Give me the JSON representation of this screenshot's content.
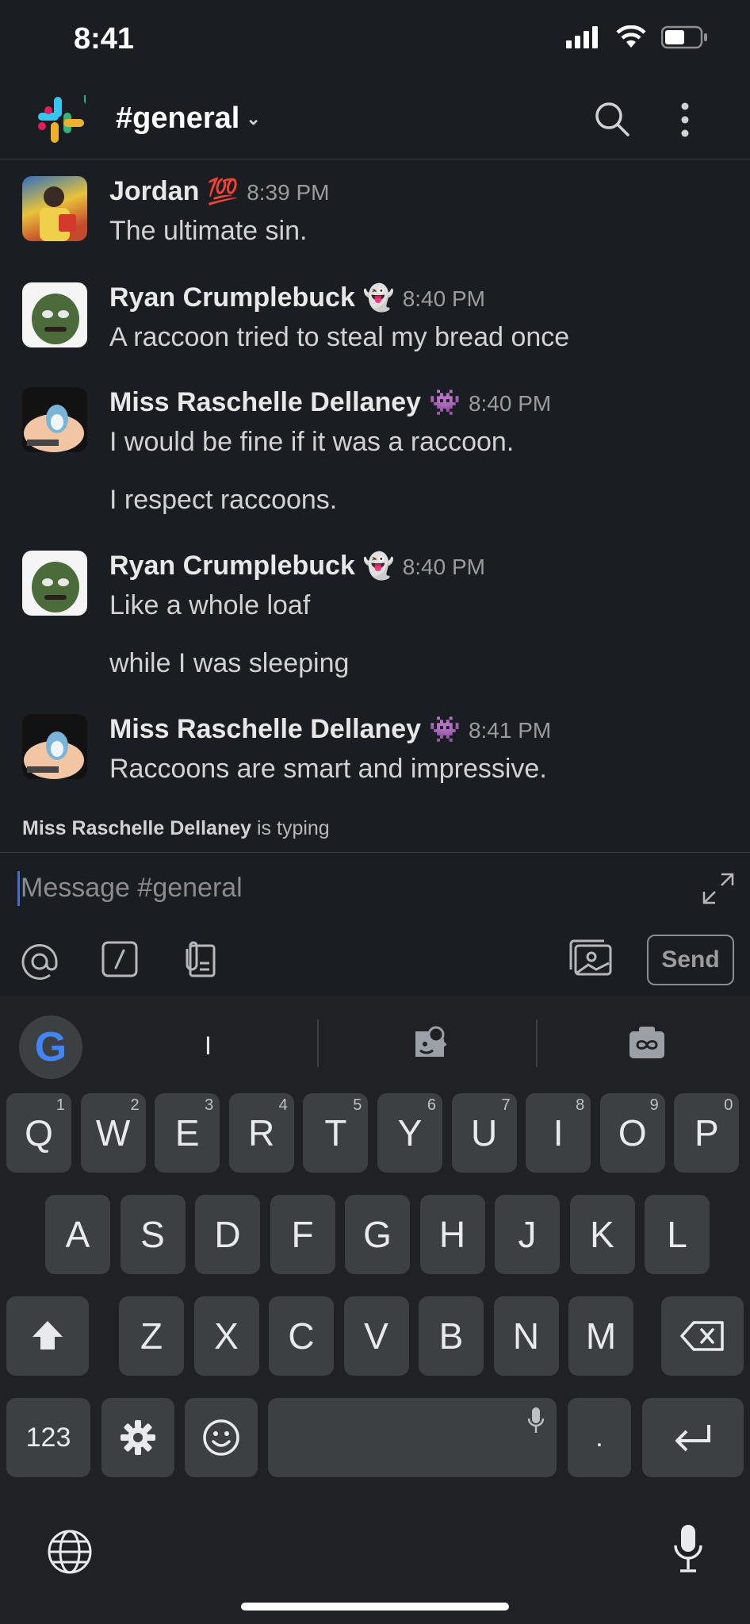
{
  "status_bar": {
    "time": "8:41"
  },
  "header": {
    "channel": "#general"
  },
  "messages": [
    {
      "author": "Jordan",
      "badge": "💯",
      "time": "8:39 PM",
      "lines": [
        "The ultimate sin."
      ]
    },
    {
      "author": "Ryan Crumplebuck",
      "badge": "👻",
      "time": "8:40 PM",
      "lines": [
        "A raccoon tried to steal my bread once"
      ]
    },
    {
      "author": "Miss Raschelle Dellaney",
      "badge": "👾",
      "time": "8:40 PM",
      "lines": [
        "I would be fine if it was a raccoon.",
        "I respect raccoons."
      ]
    },
    {
      "author": "Ryan Crumplebuck",
      "badge": "👻",
      "time": "8:40 PM",
      "lines": [
        "Like a whole loaf",
        "while I was sleeping"
      ]
    },
    {
      "author": "Miss Raschelle Dellaney",
      "badge": "👾",
      "time": "8:41 PM",
      "lines": [
        "Raccoons are smart and impressive."
      ]
    }
  ],
  "typing": {
    "name": "Miss Raschelle Dellaney",
    "suffix": " is typing"
  },
  "composer": {
    "placeholder": "Message #general",
    "send_label": "Send"
  },
  "keyboard": {
    "suggestion": "I",
    "row1": [
      "Q",
      "W",
      "E",
      "R",
      "T",
      "Y",
      "U",
      "I",
      "O",
      "P"
    ],
    "row1_hints": [
      "1",
      "2",
      "3",
      "4",
      "5",
      "6",
      "7",
      "8",
      "9",
      "0"
    ],
    "row2": [
      "A",
      "S",
      "D",
      "F",
      "G",
      "H",
      "J",
      "K",
      "L"
    ],
    "row3": [
      "Z",
      "X",
      "C",
      "V",
      "B",
      "N",
      "M"
    ],
    "numbers_label": "123",
    "period_label": "."
  }
}
